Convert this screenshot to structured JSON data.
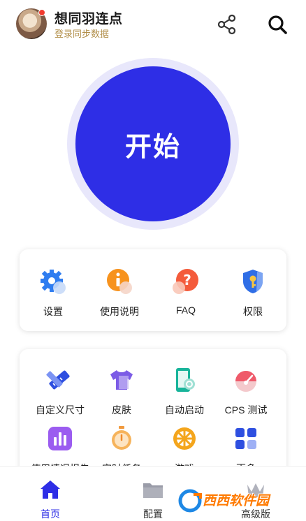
{
  "header": {
    "title": "想同羽连点",
    "subtitle": "登录同步数据",
    "share_icon": "share-icon",
    "search_icon": "search-icon"
  },
  "start": {
    "label": "开始"
  },
  "card1": {
    "items": [
      {
        "label": "设置",
        "icon": "settings-gear-icon"
      },
      {
        "label": "使用说明",
        "icon": "info-icon"
      },
      {
        "label": "FAQ",
        "icon": "question-icon"
      },
      {
        "label": "权限",
        "icon": "shield-key-icon"
      }
    ]
  },
  "card2": {
    "items": [
      {
        "label": "自定义尺寸",
        "icon": "ruler-pencil-icon"
      },
      {
        "label": "皮肤",
        "icon": "tshirt-icon"
      },
      {
        "label": "自动启动",
        "icon": "phone-autostart-icon"
      },
      {
        "label": "CPS 测试",
        "icon": "speedometer-icon"
      },
      {
        "label": "使用情况报告",
        "icon": "bar-chart-icon"
      },
      {
        "label": "定时任务",
        "icon": "stopwatch-icon"
      },
      {
        "label": "游戏",
        "icon": "wheel-icon"
      },
      {
        "label": "更多",
        "icon": "grid-icon"
      }
    ]
  },
  "nav": {
    "home": "首页",
    "config": "配置",
    "advanced": "高级版"
  },
  "watermark": {
    "text": "西西软件园"
  },
  "colors": {
    "accent": "#2e2ee6",
    "ring": "#e8e7fb",
    "subtitle": "#b28f4a",
    "badge": "#f23b2e"
  }
}
